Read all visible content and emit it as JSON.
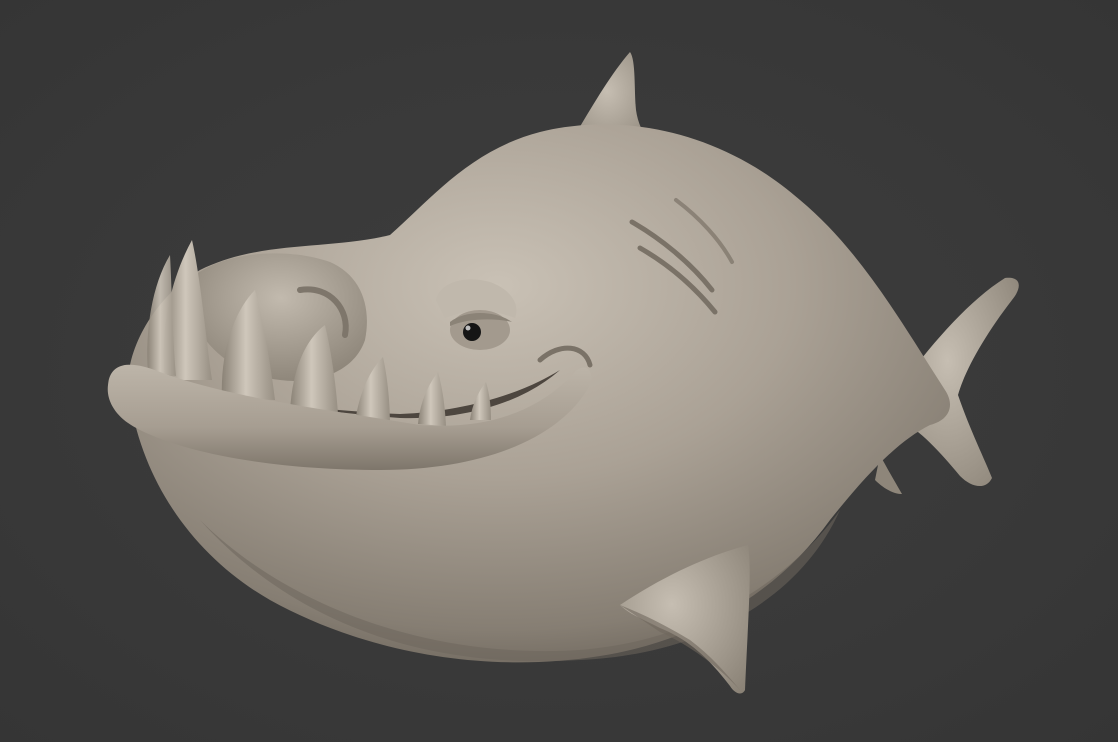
{
  "scene": {
    "subject": "sculpted-cartoon-shark",
    "colors": {
      "background": "#3a3a3a",
      "clay_base": "#a89f93",
      "clay_light": "#cbc3b7",
      "clay_shadow": "#6f675d",
      "clay_deep": "#4d463f",
      "eye_pupil": "#151515"
    }
  }
}
